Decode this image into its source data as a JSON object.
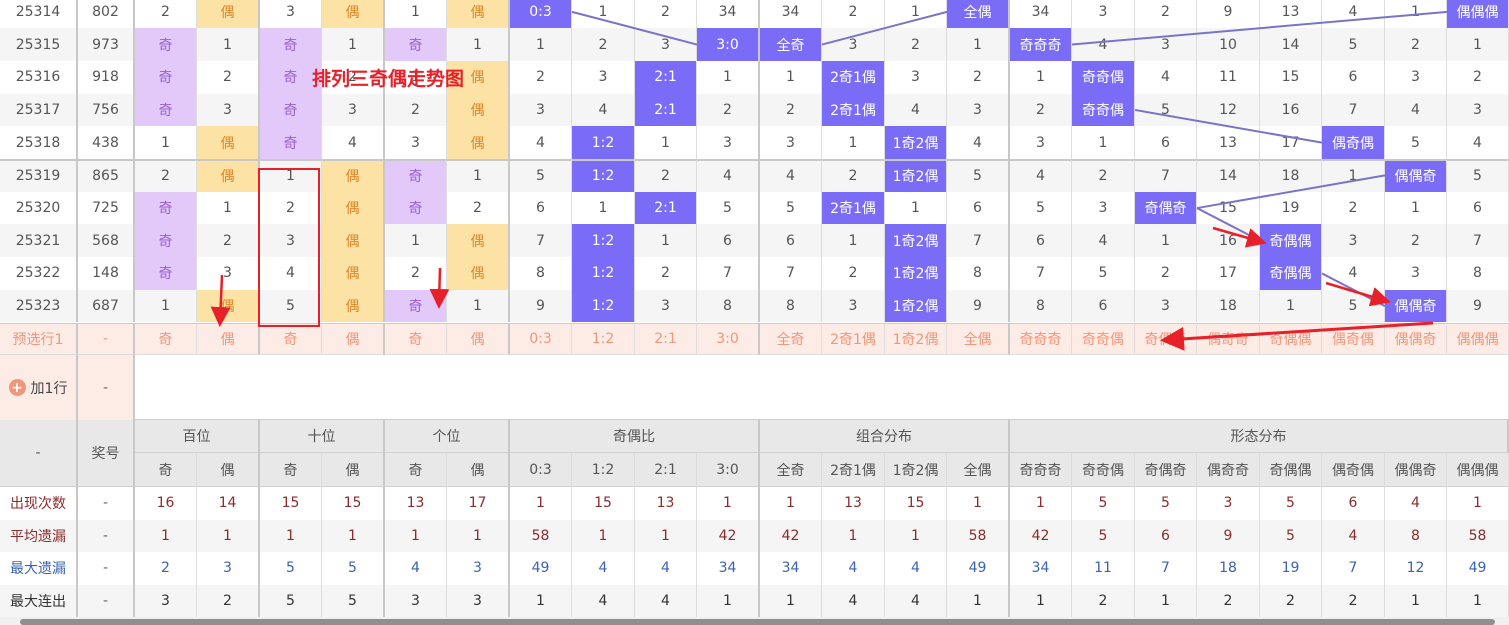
{
  "title": "排列三奇偶走势图",
  "colors": {
    "odd_bg": "#e2c9f9",
    "even_bg": "#fde2a5",
    "hit_bg": "#7b6cf7",
    "preselect_bg": "#fdece6",
    "annotation": "#e8202a"
  },
  "rows": [
    [
      "25314",
      "802",
      "2",
      "偶",
      "3",
      "偶",
      "1",
      "偶",
      "0:3",
      "1",
      "2",
      "34",
      "34",
      "2",
      "1",
      "全偶",
      "34",
      "3",
      "2",
      "9",
      "13",
      "4",
      "1",
      "偶偶偶"
    ],
    [
      "25315",
      "973",
      "奇",
      "1",
      "奇",
      "1",
      "奇",
      "1",
      "1",
      "2",
      "3",
      "3:0",
      "全奇",
      "3",
      "2",
      "1",
      "奇奇奇",
      "4",
      "3",
      "10",
      "14",
      "5",
      "2",
      "1"
    ],
    [
      "25316",
      "918",
      "奇",
      "2",
      "奇",
      "2",
      "1",
      "偶",
      "2",
      "3",
      "2:1",
      "1",
      "1",
      "2奇1偶",
      "3",
      "2",
      "1",
      "奇奇偶",
      "4",
      "11",
      "15",
      "6",
      "3",
      "2"
    ],
    [
      "25317",
      "756",
      "奇",
      "3",
      "奇",
      "3",
      "2",
      "偶",
      "3",
      "4",
      "2:1",
      "2",
      "2",
      "2奇1偶",
      "4",
      "3",
      "2",
      "奇奇偶",
      "5",
      "12",
      "16",
      "7",
      "4",
      "3"
    ],
    [
      "25318",
      "438",
      "1",
      "偶",
      "奇",
      "4",
      "3",
      "偶",
      "4",
      "1:2",
      "1",
      "3",
      "3",
      "1",
      "1奇2偶",
      "4",
      "3",
      "1",
      "6",
      "13",
      "17",
      "偶奇偶",
      "5",
      "4"
    ],
    [
      "25319",
      "865",
      "2",
      "偶",
      "1",
      "偶",
      "奇",
      "1",
      "5",
      "1:2",
      "2",
      "4",
      "4",
      "2",
      "1奇2偶",
      "5",
      "4",
      "2",
      "7",
      "14",
      "18",
      "1",
      "偶偶奇",
      "5"
    ],
    [
      "25320",
      "725",
      "奇",
      "1",
      "2",
      "偶",
      "奇",
      "2",
      "6",
      "1",
      "2:1",
      "5",
      "5",
      "2奇1偶",
      "1",
      "6",
      "5",
      "3",
      "奇偶奇",
      "15",
      "19",
      "2",
      "1",
      "6"
    ],
    [
      "25321",
      "568",
      "奇",
      "2",
      "3",
      "偶",
      "1",
      "偶",
      "7",
      "1:2",
      "1",
      "6",
      "6",
      "1",
      "1奇2偶",
      "7",
      "6",
      "4",
      "1",
      "16",
      "奇偶偶",
      "3",
      "2",
      "7"
    ],
    [
      "25322",
      "148",
      "奇",
      "3",
      "4",
      "偶",
      "2",
      "偶",
      "8",
      "1:2",
      "2",
      "7",
      "7",
      "2",
      "1奇2偶",
      "8",
      "7",
      "5",
      "2",
      "17",
      "奇偶偶",
      "4",
      "3",
      "8"
    ],
    [
      "25323",
      "687",
      "1",
      "偶",
      "5",
      "偶",
      "奇",
      "1",
      "9",
      "1:2",
      "3",
      "8",
      "8",
      "3",
      "1奇2偶",
      "9",
      "8",
      "6",
      "3",
      "18",
      "1",
      "5",
      "偶偶奇",
      "9"
    ]
  ],
  "preselect": [
    "预选行1",
    "-",
    "奇",
    "偶",
    "奇",
    "偶",
    "奇",
    "偶",
    "0:3",
    "1:2",
    "2:1",
    "3:0",
    "全奇",
    "2奇1偶",
    "1奇2偶",
    "全偶",
    "奇奇奇",
    "奇奇偶",
    "奇偶奇",
    "偶奇奇",
    "奇偶偶",
    "偶奇偶",
    "偶偶奇",
    "偶偶偶"
  ],
  "add_row": {
    "label": "加1行",
    "dash": "-"
  },
  "header": {
    "dash": "-",
    "number": "奖号",
    "groups": [
      "百位",
      "十位",
      "个位",
      "奇偶比",
      "组合分布",
      "形态分布"
    ],
    "sub": [
      "奇",
      "偶",
      "奇",
      "偶",
      "奇",
      "偶",
      "0:3",
      "1:2",
      "2:1",
      "3:0",
      "全奇",
      "2奇1偶",
      "1奇2偶",
      "全偶",
      "奇奇奇",
      "奇奇偶",
      "奇偶奇",
      "偶奇奇",
      "奇偶偶",
      "偶奇偶",
      "偶偶奇",
      "偶偶偶"
    ]
  },
  "stats": [
    {
      "label": "出现次数",
      "color": "#8b2b2b",
      "values": [
        "-",
        "16",
        "14",
        "15",
        "15",
        "13",
        "17",
        "1",
        "15",
        "13",
        "1",
        "1",
        "13",
        "15",
        "1",
        "1",
        "5",
        "5",
        "3",
        "5",
        "6",
        "4",
        "1"
      ]
    },
    {
      "label": "平均遗漏",
      "color": "#8b2b2b",
      "values": [
        "-",
        "1",
        "1",
        "1",
        "1",
        "1",
        "1",
        "58",
        "1",
        "1",
        "42",
        "42",
        "1",
        "1",
        "58",
        "42",
        "5",
        "6",
        "9",
        "5",
        "4",
        "8",
        "58"
      ]
    },
    {
      "label": "最大遗漏",
      "color": "#3a63b0",
      "values": [
        "-",
        "2",
        "3",
        "5",
        "5",
        "4",
        "3",
        "49",
        "4",
        "4",
        "34",
        "34",
        "4",
        "4",
        "49",
        "34",
        "11",
        "7",
        "18",
        "19",
        "7",
        "12",
        "49"
      ]
    },
    {
      "label": "最大连出",
      "color": "#333333",
      "values": [
        "-",
        "3",
        "2",
        "5",
        "5",
        "3",
        "3",
        "1",
        "4",
        "4",
        "1",
        "1",
        "4",
        "4",
        "1",
        "1",
        "2",
        "1",
        "2",
        "2",
        "2",
        "1",
        "1"
      ]
    }
  ]
}
